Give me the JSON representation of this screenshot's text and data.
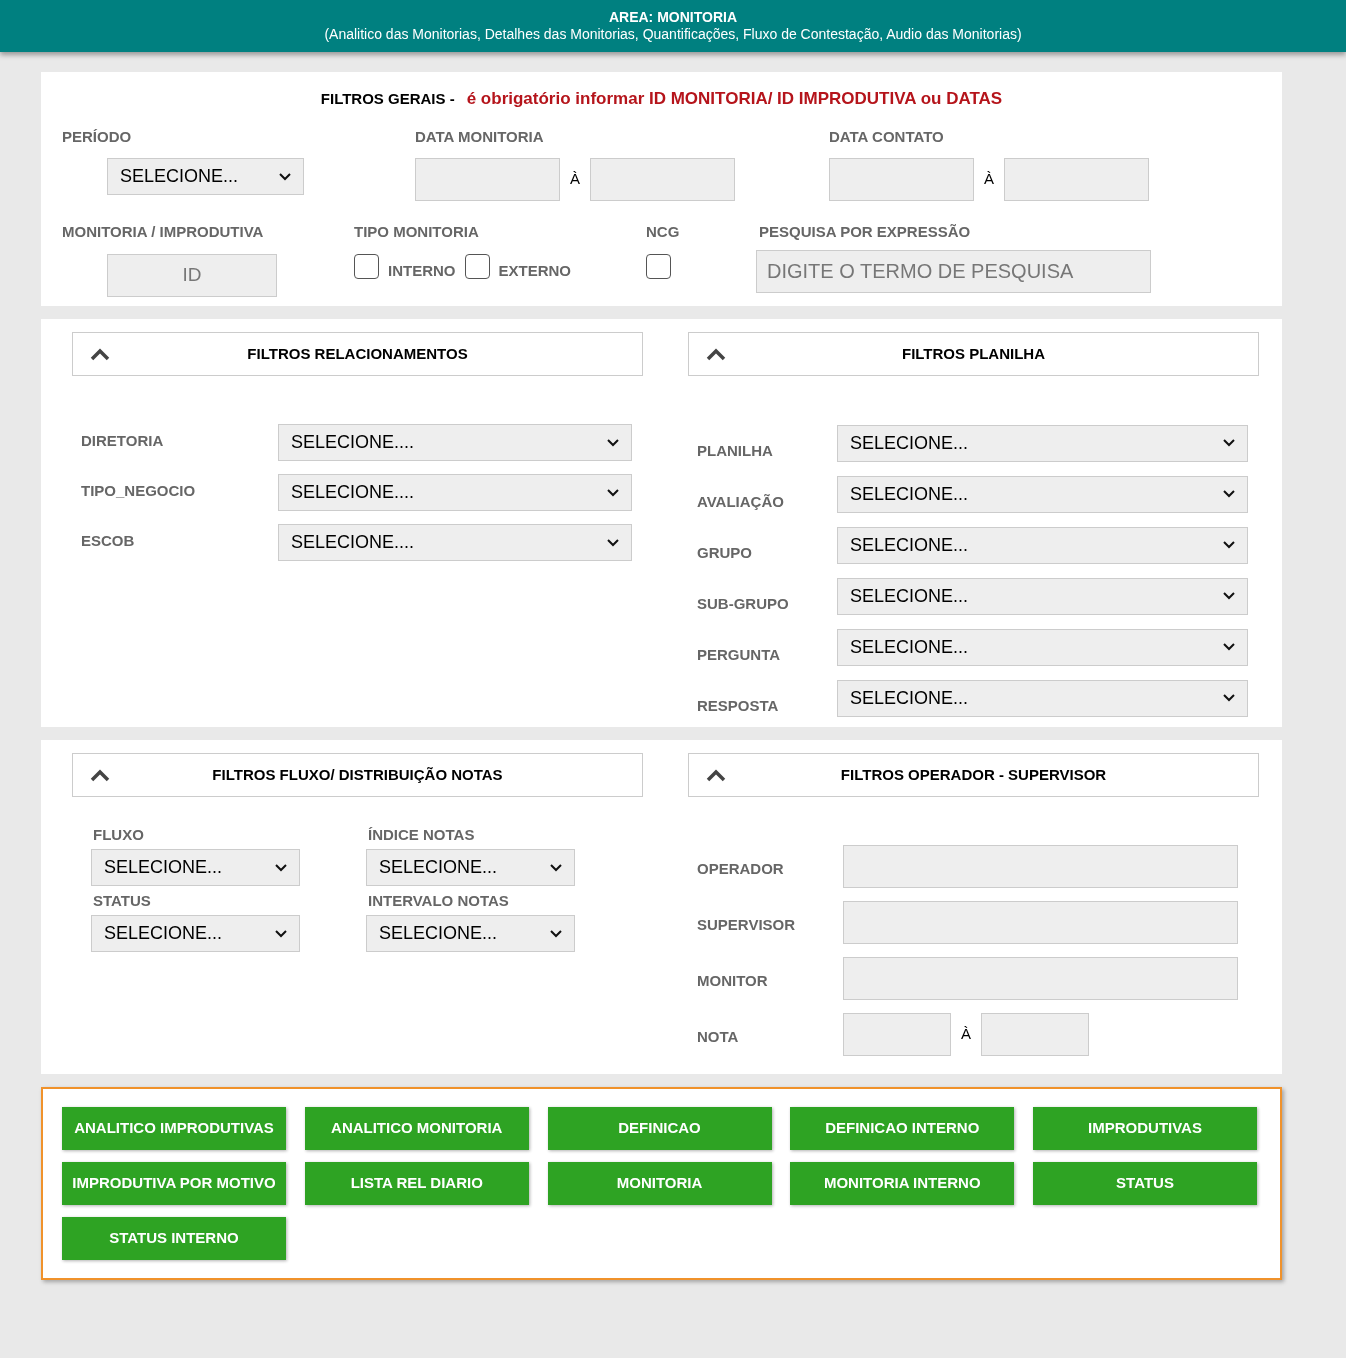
{
  "header": {
    "title": "AREA: MONITORIA",
    "subtitle": "(Analitico das Monitorias, Detalhes das Monitorias, Quantificações, Fluxo de Contestação, Audio das Monitorias)"
  },
  "general_filters": {
    "title": "FILTROS GERAIS -",
    "warning": "é obrigatório informar ID MONITORIA/ ID IMPRODUTIVA ou DATAS",
    "periodo": {
      "label": "PERÍODO",
      "value": "SELECIONE..."
    },
    "data_monitoria": {
      "label": "DATA MONITORIA",
      "separator": "À"
    },
    "data_contato": {
      "label": "DATA CONTATO",
      "separator": "À"
    },
    "monitoria_improdutiva": {
      "label": "MONITORIA / IMPRODUTIVA",
      "placeholder": "ID"
    },
    "tipo_monitoria": {
      "label": "TIPO MONITORIA",
      "options": [
        {
          "label": "INTERNO",
          "checked": false
        },
        {
          "label": "EXTERNO",
          "checked": false
        }
      ]
    },
    "ncg": {
      "label": "NCG",
      "checked": false
    },
    "pesquisa": {
      "label": "PESQUISA POR EXPRESSÃO",
      "placeholder": "DIGITE O TERMO DE PESQUISA"
    }
  },
  "panels": [
    {
      "title": "FILTROS RELACIONAMENTOS",
      "expanded": true,
      "fields": [
        {
          "kind": "select",
          "label": "DIRETORIA",
          "value": "SELECIONE...."
        },
        {
          "kind": "select",
          "label": "TIPO_NEGOCIO",
          "value": "SELECIONE...."
        },
        {
          "kind": "select",
          "label": "ESCOB",
          "value": "SELECIONE...."
        }
      ]
    },
    {
      "title": "FILTROS PLANILHA",
      "expanded": true,
      "fields": [
        {
          "kind": "select",
          "label": "PLANILHA",
          "value": "SELECIONE..."
        },
        {
          "kind": "select",
          "label": "AVALIAÇÃO",
          "value": "SELECIONE..."
        },
        {
          "kind": "select",
          "label": "GRUPO",
          "value": "SELECIONE..."
        },
        {
          "kind": "select",
          "label": "SUB-GRUPO",
          "value": "SELECIONE..."
        },
        {
          "kind": "select",
          "label": "PERGUNTA",
          "value": "SELECIONE..."
        },
        {
          "kind": "select",
          "label": "RESPOSTA",
          "value": "SELECIONE..."
        }
      ]
    },
    {
      "title": "FILTROS FLUXO/ DISTRIBUIÇÃO NOTAS",
      "expanded": true,
      "fields": [
        {
          "kind": "stacked",
          "label": "FLUXO",
          "value": "SELECIONE..."
        },
        {
          "kind": "stacked",
          "label": "ÍNDICE NOTAS",
          "value": "SELECIONE..."
        },
        {
          "kind": "stacked",
          "label": "STATUS",
          "value": "SELECIONE..."
        },
        {
          "kind": "stacked",
          "label": "INTERVALO NOTAS",
          "value": "SELECIONE..."
        }
      ]
    },
    {
      "title": "FILTROS OPERADOR - SUPERVISOR",
      "expanded": true,
      "fields": [
        {
          "kind": "input",
          "label": "OPERADOR"
        },
        {
          "kind": "input",
          "label": "SUPERVISOR"
        },
        {
          "kind": "input",
          "label": "MONITOR"
        },
        {
          "kind": "range",
          "label": "NOTA",
          "separator": "À"
        }
      ]
    }
  ],
  "report_buttons": [
    "ANALITICO IMPRODUTIVAS",
    "ANALITICO MONITORIA",
    "DEFINICAO",
    "DEFINICAO INTERNO",
    "IMPRODUTIVAS",
    "IMPRODUTIVA POR MOTIVO",
    "LISTA REL DIARIO",
    "MONITORIA",
    "MONITORIA INTERNO",
    "STATUS",
    "STATUS INTERNO"
  ]
}
